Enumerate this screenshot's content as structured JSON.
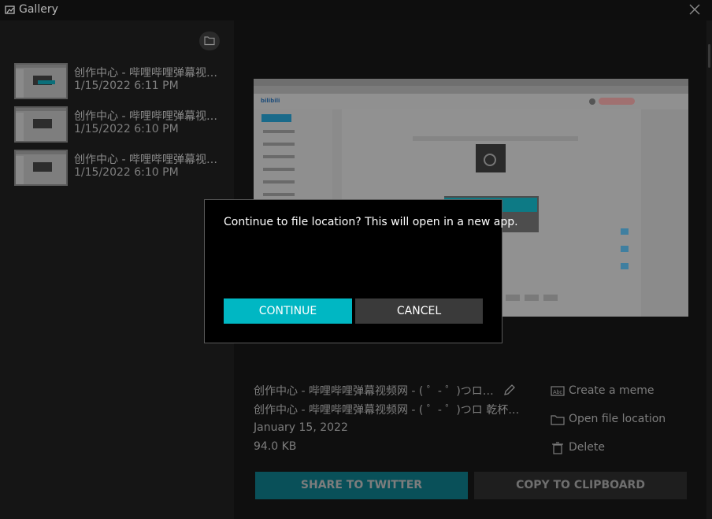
{
  "titlebar": {
    "title": "Gallery"
  },
  "gallery": {
    "items": [
      {
        "name": "创作中心 - 哔哩哔哩弹幕视频网 - ( ゜- ゜)つロ 乾杯~ - bilibili",
        "date": "1/15/2022 6:11 PM"
      },
      {
        "name": "创作中心 - 哔哩哔哩弹幕视频网 - ( ゜- ゜)つロ 乾杯~ - bilibili",
        "date": "1/15/2022 6:10 PM"
      },
      {
        "name": "创作中心 - 哔哩哔哩弹幕视频网 - ( ゜- ゜)つロ 乾杯~ - bilibili",
        "date": "1/15/2022 6:10 PM"
      }
    ]
  },
  "details": {
    "title": "创作中心 - 哔哩哔哩弹幕视频网 - ( ゜- ゜)つロ 乾杯~ - bilibili",
    "subtitle": "创作中心 - 哔哩哔哩弹幕视频网 - ( ゜- ゜)つロ 乾杯~ - bilibili",
    "date": "January 15, 2022",
    "size": "94.0 KB"
  },
  "actions": {
    "create_meme": "Create a meme",
    "open_location": "Open file location",
    "delete": "Delete"
  },
  "buttons": {
    "share_twitter": "SHARE TO TWITTER",
    "copy_clipboard": "COPY TO CLIPBOARD"
  },
  "dialog": {
    "message": "Continue to file location? This will open in a new app.",
    "continue_label": "CONTINUE",
    "cancel_label": "CANCEL"
  },
  "colors": {
    "accent": "#00b7c3",
    "twitter_button": "#095059",
    "dialog_bg": "#000000"
  }
}
